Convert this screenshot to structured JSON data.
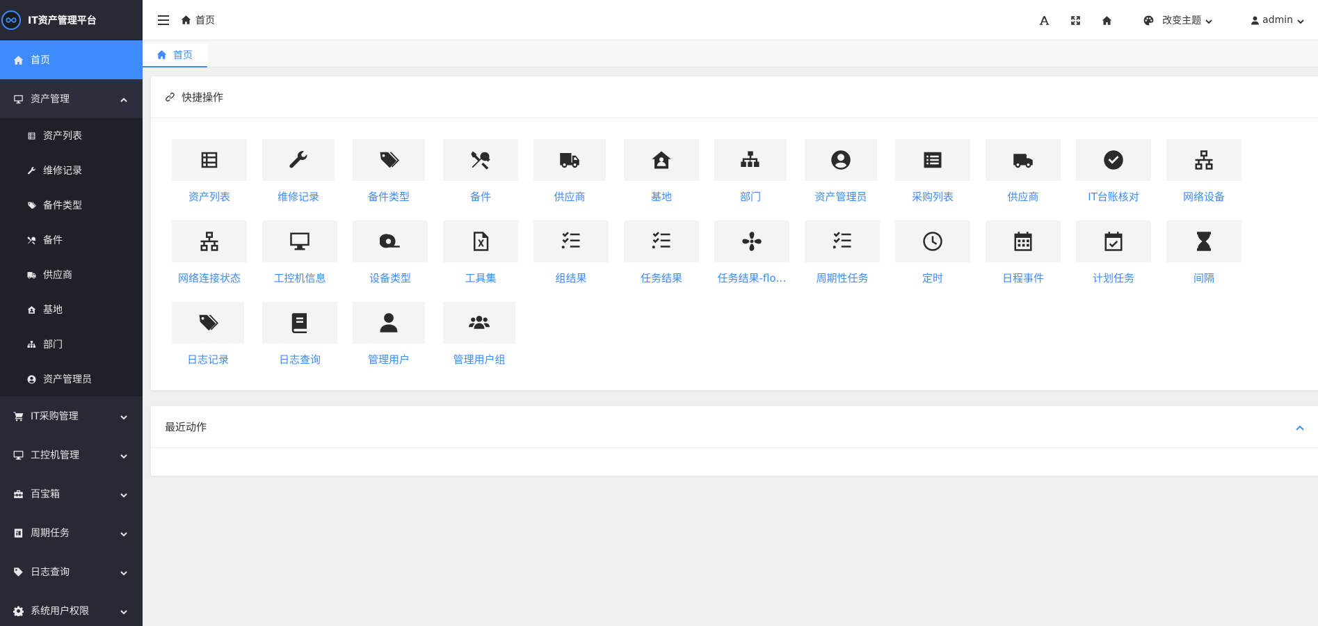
{
  "brand": {
    "title": "IT资产管理平台"
  },
  "sidebar": {
    "home": {
      "label": "首页",
      "icon": "home-icon"
    },
    "asset_mgmt": {
      "label": "资产管理",
      "icon": "monitor-icon",
      "children": [
        {
          "label": "资产列表",
          "icon": "list-icon"
        },
        {
          "label": "维修记录",
          "icon": "wrench-icon"
        },
        {
          "label": "备件类型",
          "icon": "tags-icon"
        },
        {
          "label": "备件",
          "icon": "tools-icon"
        },
        {
          "label": "供应商",
          "icon": "truck-icon"
        },
        {
          "label": "基地",
          "icon": "house-icon"
        },
        {
          "label": "部门",
          "icon": "sitemap-icon"
        },
        {
          "label": "资产管理员",
          "icon": "user-circle-icon"
        }
      ]
    },
    "groups": [
      {
        "label": "IT采购管理",
        "icon": "cart-icon"
      },
      {
        "label": "工控机管理",
        "icon": "desktop-icon"
      },
      {
        "label": "百宝箱",
        "icon": "toolbox-icon"
      },
      {
        "label": "周期任务",
        "icon": "task-icon"
      },
      {
        "label": "日志查询",
        "icon": "tag-icon"
      },
      {
        "label": "系统用户权限",
        "icon": "gear-icon"
      }
    ]
  },
  "header": {
    "breadcrumb": "首页",
    "theme_label": "改变主题",
    "user_label": "admin"
  },
  "tabs": [
    {
      "label": "首页"
    }
  ],
  "quick": {
    "title": "快捷操作",
    "items": [
      {
        "label": "资产列表",
        "icon": "list-icon"
      },
      {
        "label": "维修记录",
        "icon": "wrench-icon"
      },
      {
        "label": "备件类型",
        "icon": "tags-icon"
      },
      {
        "label": "备件",
        "icon": "tools-icon"
      },
      {
        "label": "供应商",
        "icon": "truck-icon"
      },
      {
        "label": "基地",
        "icon": "house-icon"
      },
      {
        "label": "部门",
        "icon": "sitemap-icon"
      },
      {
        "label": "资产管理员",
        "icon": "user-circle-icon"
      },
      {
        "label": "采购列表",
        "icon": "list-alt-icon"
      },
      {
        "label": "供应商",
        "icon": "van-icon"
      },
      {
        "label": "IT台账核对",
        "icon": "check-circle-icon"
      },
      {
        "label": "网络设备",
        "icon": "network-icon"
      },
      {
        "label": "网络连接状态",
        "icon": "network-icon"
      },
      {
        "label": "工控机信息",
        "icon": "desktop-icon"
      },
      {
        "label": "设备类型",
        "icon": "tape-icon"
      },
      {
        "label": "工具集",
        "icon": "excel-file-icon"
      },
      {
        "label": "组结果",
        "icon": "tasks-icon"
      },
      {
        "label": "任务结果",
        "icon": "tasks-icon"
      },
      {
        "label": "任务结果-flo…",
        "icon": "fan-icon"
      },
      {
        "label": "周期性任务",
        "icon": "tasks-icon"
      },
      {
        "label": "定时",
        "icon": "clock-icon"
      },
      {
        "label": "日程事件",
        "icon": "calendar-icon"
      },
      {
        "label": "计划任务",
        "icon": "calendar-check-icon"
      },
      {
        "label": "间隔",
        "icon": "hourglass-icon"
      },
      {
        "label": "日志记录",
        "icon": "tags-icon"
      },
      {
        "label": "日志查询",
        "icon": "book-icon"
      },
      {
        "label": "管理用户",
        "icon": "user-icon"
      },
      {
        "label": "管理用户组",
        "icon": "users-icon"
      }
    ]
  },
  "recent": {
    "title": "最近动作"
  },
  "colors": {
    "accent": "#3d8bfd",
    "sidebar_bg": "#272a35",
    "submenu_bg": "#1f2129"
  }
}
